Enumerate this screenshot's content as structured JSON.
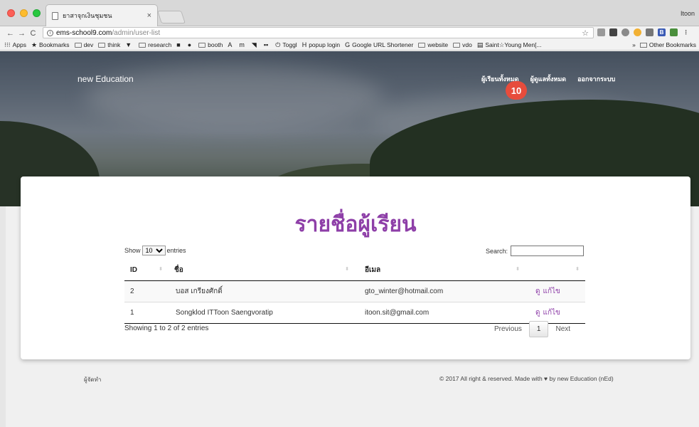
{
  "browser": {
    "tab_title": "ยาสาจุกเงินชุมชน",
    "tab_close": "×",
    "profile": "Itoon",
    "url_host": "ems-school9.com",
    "url_path": "/admin/user-list",
    "nav_back": "←",
    "nav_forward": "→",
    "nav_reload": "C",
    "bookmark_star": "☆",
    "bookmarks": [
      {
        "label": "Apps",
        "icon": "apps-grid-icon",
        "glyph": "⁝⁝⁝"
      },
      {
        "label": "Bookmarks",
        "icon": "star-icon",
        "glyph": "★"
      },
      {
        "label": "dev",
        "icon": "folder-icon"
      },
      {
        "label": "think",
        "icon": "folder-icon"
      },
      {
        "label": "",
        "icon": "vuejs-icon",
        "glyph": "▼"
      },
      {
        "label": "research",
        "icon": "folder-icon"
      },
      {
        "label": "",
        "icon": "bookmark-blue-icon",
        "glyph": "■"
      },
      {
        "label": "",
        "icon": "leaf-icon",
        "glyph": "●"
      },
      {
        "label": "booth",
        "icon": "folder-icon"
      },
      {
        "label": "",
        "icon": "a-icon",
        "glyph": "A"
      },
      {
        "label": "",
        "icon": "m-icon",
        "glyph": "m"
      },
      {
        "label": "",
        "icon": "colorful-icon",
        "glyph": "◥"
      },
      {
        "label": "",
        "icon": "dots-icon",
        "glyph": "▪▪"
      },
      {
        "label": "Toggl",
        "icon": "toggl-icon",
        "glyph": "⏻"
      },
      {
        "label": "popup login",
        "icon": "h-icon",
        "glyph": "H"
      },
      {
        "label": "Google URL Shortener",
        "icon": "google-icon",
        "glyph": "G"
      },
      {
        "label": "website",
        "icon": "folder-icon"
      },
      {
        "label": "vdo",
        "icon": "folder-icon"
      },
      {
        "label": "Saint☆Young Men[...",
        "icon": "page-icon",
        "glyph": "▤"
      }
    ],
    "bookmarks_more": "»",
    "other_bookmarks": "Other Bookmarks"
  },
  "site": {
    "brand": "new Education",
    "nav": [
      "ผู้เรียนทั้งหมด",
      "ผู้ดูแลทั้งหมด",
      "ออกจากระบบ"
    ],
    "badge": "10"
  },
  "page": {
    "title": "รายชื่อผู้เรียน",
    "length": {
      "show": "Show",
      "value": "10",
      "entries": "entries"
    },
    "search_label": "Search:",
    "columns": [
      "ID",
      "ชื่อ",
      "อีเมล",
      ""
    ],
    "rows": [
      {
        "id": "2",
        "name": "บอส เกรียงศักดิ์",
        "email": "gto_winter@hotmail.com",
        "view": "ดู",
        "edit": "แก้ไข"
      },
      {
        "id": "1",
        "name": "Songklod ITToon Saengvoratip",
        "email": "itoon.sit@gmail.com",
        "view": "ดู",
        "edit": "แก้ไข"
      }
    ],
    "info": "Showing 1 to 2 of 2 entries",
    "pager": {
      "previous": "Previous",
      "current": "1",
      "next": "Next"
    }
  },
  "footer": {
    "left": "ผู้จัดทำ",
    "right": "© 2017 All right & reserved. Made with ♥ by new Education (nEd)"
  },
  "colors": {
    "accent": "#8e3fa8",
    "badge": "#e74c3c"
  }
}
